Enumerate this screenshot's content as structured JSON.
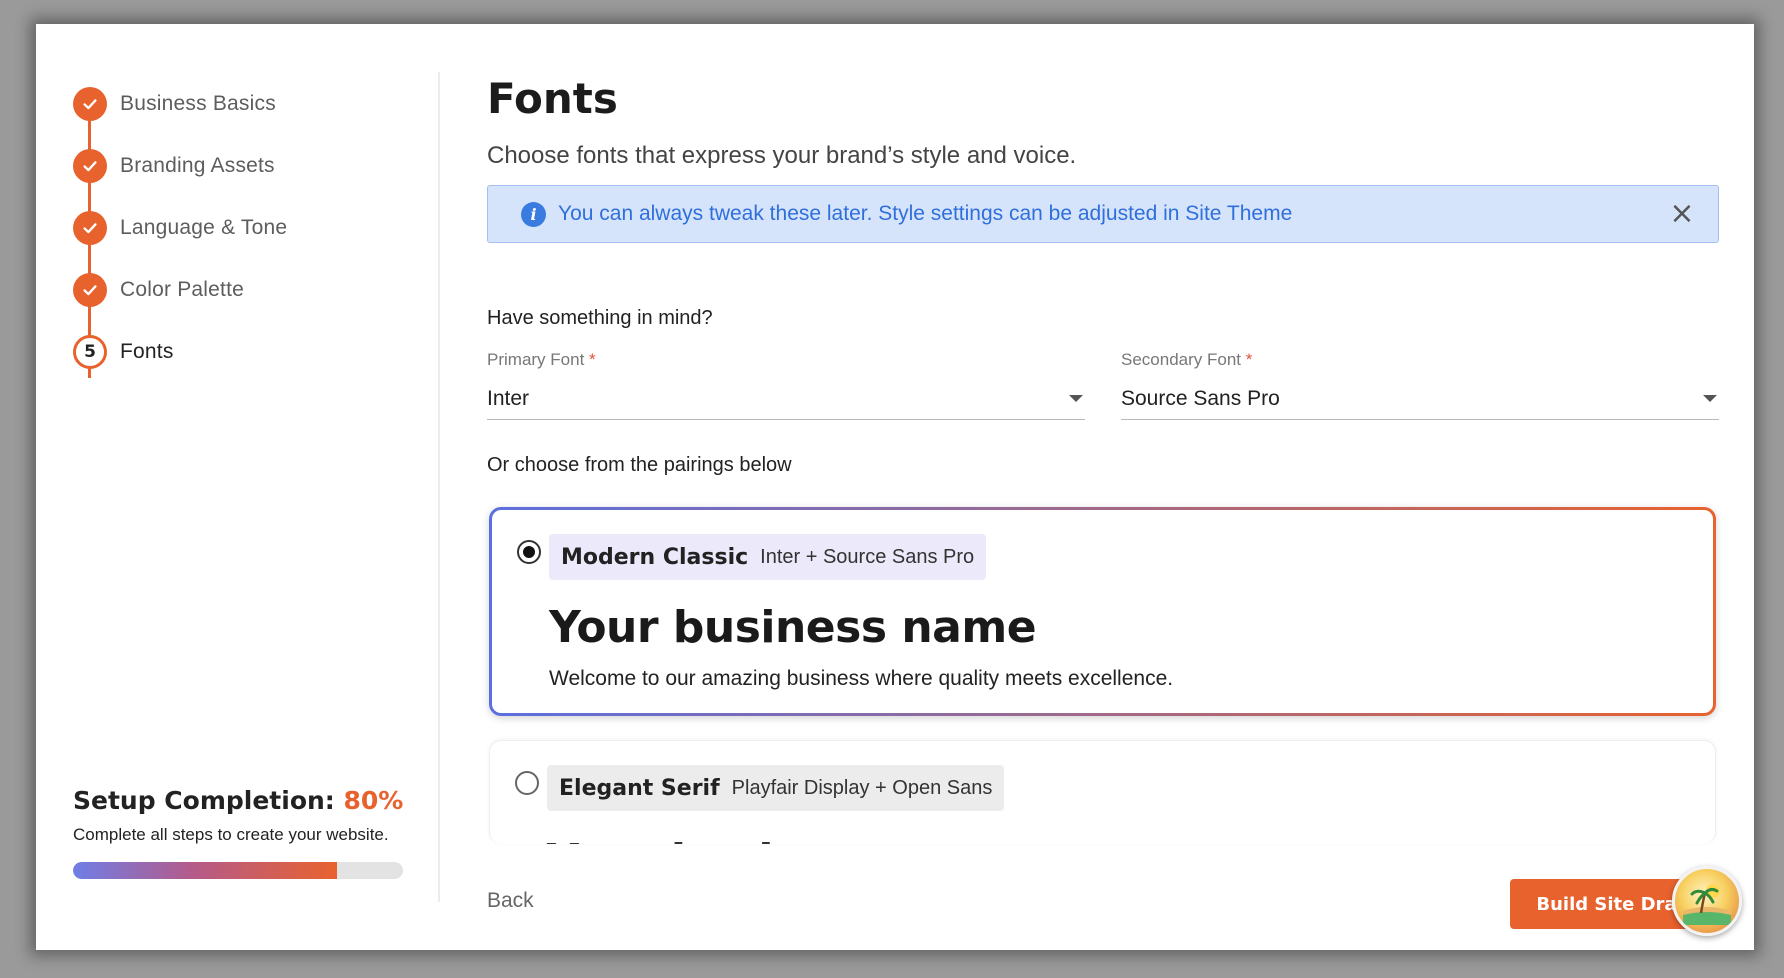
{
  "sidebar": {
    "steps": [
      {
        "number": "1",
        "label": "Business Basics",
        "state": "done"
      },
      {
        "number": "2",
        "label": "Branding Assets",
        "state": "done"
      },
      {
        "number": "3",
        "label": "Language & Tone",
        "state": "done"
      },
      {
        "number": "4",
        "label": "Color Palette",
        "state": "done"
      },
      {
        "number": "5",
        "label": "Fonts",
        "state": "current"
      }
    ],
    "completion": {
      "title": "Setup Completion:",
      "percent_text": "80%",
      "percent_value": 80,
      "description": "Complete all steps to create your website."
    }
  },
  "main": {
    "title": "Fonts",
    "subtitle": "Choose fonts that express your brand’s style and voice.",
    "banner": {
      "text": "You can always tweak these later. Style settings can be adjusted in Site Theme",
      "close_label": "×"
    },
    "prompt": "Have something in mind?",
    "primary_font": {
      "label": "Primary Font",
      "required_mark": "*",
      "value": "Inter"
    },
    "secondary_font": {
      "label": "Secondary Font",
      "required_mark": "*",
      "value": "Source Sans Pro"
    },
    "or_choose": "Or choose from the pairings below",
    "pairings": [
      {
        "name": "Modern Classic",
        "fonts": "Inter + Source Sans Pro",
        "preview_heading": "Your business name",
        "preview_body": "Welcome to our amazing business where quality meets excellence.",
        "selected": true
      },
      {
        "name": "Elegant Serif",
        "fonts": "Playfair Display + Open Sans",
        "preview_heading": "Your business name",
        "selected": false
      }
    ],
    "back_label": "Back",
    "build_label": "Build Site Draft"
  },
  "colors": {
    "accent": "#e8622e",
    "banner_bg": "#d6e4fb",
    "banner_text": "#2f6fdc",
    "gradient_start": "#6f7ee6"
  },
  "icons": {
    "step_done": "check-icon",
    "banner": "info-icon",
    "close": "close-icon",
    "dropdown": "chevron-down-icon",
    "floating": "beach-avatar-icon"
  }
}
